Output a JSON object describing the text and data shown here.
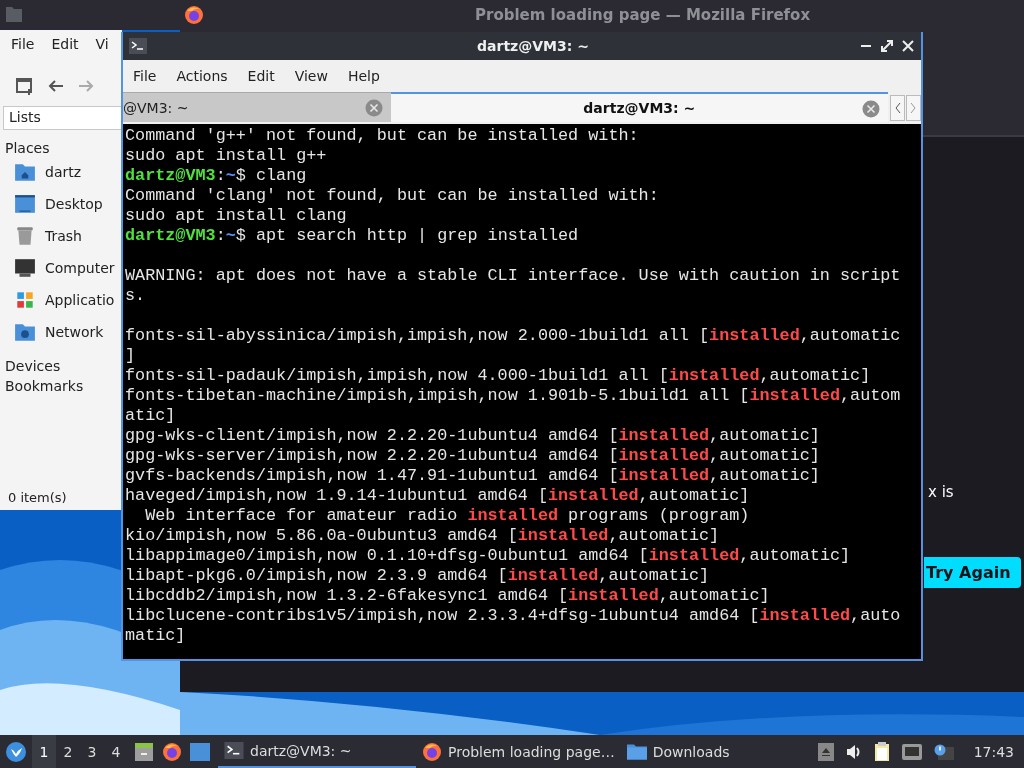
{
  "firefox_window": {
    "title": "Problem loading page — Mozilla Firefox",
    "error_text": "x is",
    "button": "Try Again"
  },
  "file_manager": {
    "menu": [
      "File",
      "Edit",
      "Vi"
    ],
    "nav": [
      {
        "kind": "back",
        "disabled": false
      },
      {
        "kind": "forward",
        "disabled": true
      }
    ],
    "location": "Lists",
    "sections": [
      {
        "title": "Places",
        "items": [
          {
            "label": "dartz",
            "kind": "home"
          },
          {
            "label": "Desktop",
            "kind": "desktop"
          },
          {
            "label": "Trash",
            "kind": "trash"
          },
          {
            "label": "Computer",
            "kind": "computer"
          },
          {
            "label": "Applicatio",
            "kind": "apps"
          },
          {
            "label": "Network",
            "kind": "network"
          }
        ]
      },
      {
        "title": "Devices"
      },
      {
        "title": "Bookmarks"
      }
    ],
    "status": "0 item(s)"
  },
  "terminal": {
    "title": "dartz@VM3: ~",
    "menu": [
      "File",
      "Actions",
      "Edit",
      "View",
      "Help"
    ],
    "tabs": [
      {
        "label": "@VM3: ~",
        "selected": false
      },
      {
        "label": "dartz@VM3: ~",
        "selected": true
      }
    ],
    "lines": [
      {
        "kind": "output",
        "spans": [
          {
            "text": "Command 'g++' not found, but can be installed with:",
            "kind": "text"
          }
        ]
      },
      {
        "kind": "output",
        "spans": [
          {
            "text": "sudo apt install g++",
            "kind": "text"
          }
        ]
      },
      {
        "kind": "output",
        "spans": [
          {
            "text": "dartz@VM3",
            "kind": "user"
          },
          {
            "text": ":",
            "kind": "text"
          },
          {
            "text": "~",
            "kind": "path"
          },
          {
            "text": "$ clang",
            "kind": "text"
          }
        ]
      },
      {
        "kind": "output",
        "spans": [
          {
            "text": "Command 'clang' not found, but can be installed with:",
            "kind": "text"
          }
        ]
      },
      {
        "kind": "output",
        "spans": [
          {
            "text": "sudo apt install clang",
            "kind": "text"
          }
        ]
      },
      {
        "kind": "output",
        "spans": [
          {
            "text": "dartz@VM3",
            "kind": "user"
          },
          {
            "text": ":",
            "kind": "text"
          },
          {
            "text": "~",
            "kind": "path"
          },
          {
            "text": "$ apt search http | grep installed",
            "kind": "text"
          }
        ]
      },
      {
        "kind": "blank"
      },
      {
        "kind": "output",
        "spans": [
          {
            "text": "WARNING: apt does not have a stable CLI interface. Use with caution in script",
            "kind": "text"
          }
        ]
      },
      {
        "kind": "output",
        "spans": [
          {
            "text": "s.",
            "kind": "text"
          }
        ]
      },
      {
        "kind": "blank"
      },
      {
        "kind": "output",
        "spans": [
          {
            "text": "fonts-sil-abyssinica/impish,impish,now 2.000-1build1 all [",
            "kind": "text"
          },
          {
            "text": "installed",
            "kind": "match"
          },
          {
            "text": ",automatic",
            "kind": "text"
          }
        ]
      },
      {
        "kind": "output",
        "spans": [
          {
            "text": "]",
            "kind": "text"
          }
        ]
      },
      {
        "kind": "output",
        "spans": [
          {
            "text": "fonts-sil-padauk/impish,impish,now 4.000-1build1 all [",
            "kind": "text"
          },
          {
            "text": "installed",
            "kind": "match"
          },
          {
            "text": ",automatic]",
            "kind": "text"
          }
        ]
      },
      {
        "kind": "output",
        "spans": [
          {
            "text": "fonts-tibetan-machine/impish,impish,now 1.901b-5.1build1 all [",
            "kind": "text"
          },
          {
            "text": "installed",
            "kind": "match"
          },
          {
            "text": ",autom",
            "kind": "text"
          }
        ]
      },
      {
        "kind": "output",
        "spans": [
          {
            "text": "atic]",
            "kind": "text"
          }
        ]
      },
      {
        "kind": "output",
        "spans": [
          {
            "text": "gpg-wks-client/impish,now 2.2.20-1ubuntu4 amd64 [",
            "kind": "text"
          },
          {
            "text": "installed",
            "kind": "match"
          },
          {
            "text": ",automatic]",
            "kind": "text"
          }
        ]
      },
      {
        "kind": "output",
        "spans": [
          {
            "text": "gpg-wks-server/impish,now 2.2.20-1ubuntu4 amd64 [",
            "kind": "text"
          },
          {
            "text": "installed",
            "kind": "match"
          },
          {
            "text": ",automatic]",
            "kind": "text"
          }
        ]
      },
      {
        "kind": "output",
        "spans": [
          {
            "text": "gvfs-backends/impish,now 1.47.91-1ubuntu1 amd64 [",
            "kind": "text"
          },
          {
            "text": "installed",
            "kind": "match"
          },
          {
            "text": ",automatic]",
            "kind": "text"
          }
        ]
      },
      {
        "kind": "output",
        "spans": [
          {
            "text": "haveged/impish,now 1.9.14-1ubuntu1 amd64 [",
            "kind": "text"
          },
          {
            "text": "installed",
            "kind": "match"
          },
          {
            "text": ",automatic]",
            "kind": "text"
          }
        ]
      },
      {
        "kind": "output",
        "spans": [
          {
            "text": "  Web interface for amateur radio ",
            "kind": "text"
          },
          {
            "text": "installed",
            "kind": "match"
          },
          {
            "text": " programs (program)",
            "kind": "text"
          }
        ]
      },
      {
        "kind": "output",
        "spans": [
          {
            "text": "kio/impish,now 5.86.0a-0ubuntu3 amd64 [",
            "kind": "text"
          },
          {
            "text": "installed",
            "kind": "match"
          },
          {
            "text": ",automatic]",
            "kind": "text"
          }
        ]
      },
      {
        "kind": "output",
        "spans": [
          {
            "text": "libappimage0/impish,now 0.1.10+dfsg-0ubuntu1 amd64 [",
            "kind": "text"
          },
          {
            "text": "installed",
            "kind": "match"
          },
          {
            "text": ",automatic]",
            "kind": "text"
          }
        ]
      },
      {
        "kind": "output",
        "spans": [
          {
            "text": "libapt-pkg6.0/impish,now 2.3.9 amd64 [",
            "kind": "text"
          },
          {
            "text": "installed",
            "kind": "match"
          },
          {
            "text": ",automatic]",
            "kind": "text"
          }
        ]
      },
      {
        "kind": "output",
        "spans": [
          {
            "text": "libcddb2/impish,now 1.3.2-6fakesync1 amd64 [",
            "kind": "text"
          },
          {
            "text": "installed",
            "kind": "match"
          },
          {
            "text": ",automatic]",
            "kind": "text"
          }
        ]
      },
      {
        "kind": "output",
        "spans": [
          {
            "text": "libclucene-contribs1v5/impish,now 2.3.3.4+dfsg-1ubuntu4 amd64 [",
            "kind": "text"
          },
          {
            "text": "installed",
            "kind": "match"
          },
          {
            "text": ",auto",
            "kind": "text"
          }
        ]
      },
      {
        "kind": "output",
        "spans": [
          {
            "text": "matic]",
            "kind": "text"
          }
        ]
      }
    ]
  },
  "taskbar": {
    "workspaces": [
      {
        "label": "1",
        "selected": true
      },
      {
        "label": "2",
        "selected": false
      },
      {
        "label": "3",
        "selected": false
      },
      {
        "label": "4",
        "selected": false
      }
    ],
    "tasks": [
      {
        "label": "dartz@VM3: ~",
        "kind": "terminal",
        "selected": true
      },
      {
        "label": "Problem loading page…",
        "kind": "browser",
        "selected": false
      },
      {
        "label": "Downloads",
        "kind": "folder",
        "selected": false
      }
    ],
    "clock": "17:43"
  }
}
